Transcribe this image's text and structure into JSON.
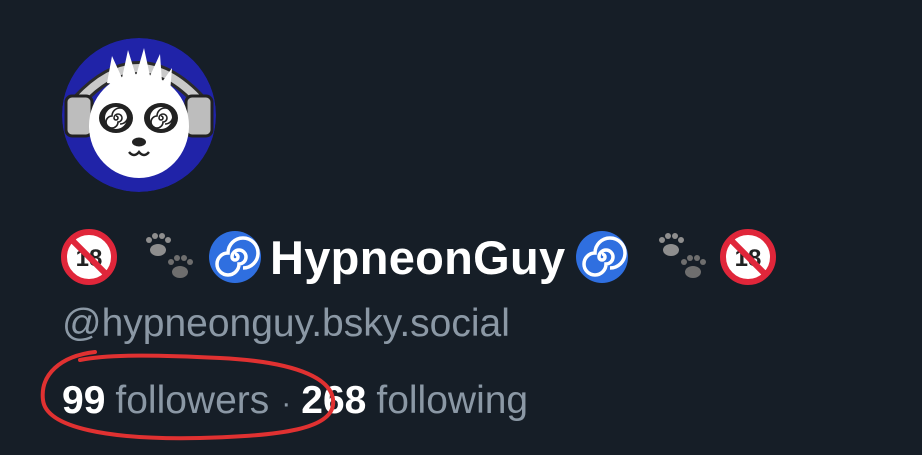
{
  "profile": {
    "display_name": "HypneonGuy",
    "handle": "@hypneonguy.bsky.social",
    "avatar_icon": "panda-avatar-icon",
    "name_decorations": [
      "no-under-18-icon",
      "paw-prints-icon",
      "cyclone-icon",
      "cyclone-icon",
      "paw-prints-icon",
      "no-under-18-icon"
    ]
  },
  "stats": {
    "followers_count": "99",
    "followers_label": "followers",
    "separator": "·",
    "following_count": "268",
    "following_label": "following"
  },
  "colors": {
    "background": "#161e27",
    "secondary_text": "#8b98a5",
    "annotation": "#e03131"
  }
}
